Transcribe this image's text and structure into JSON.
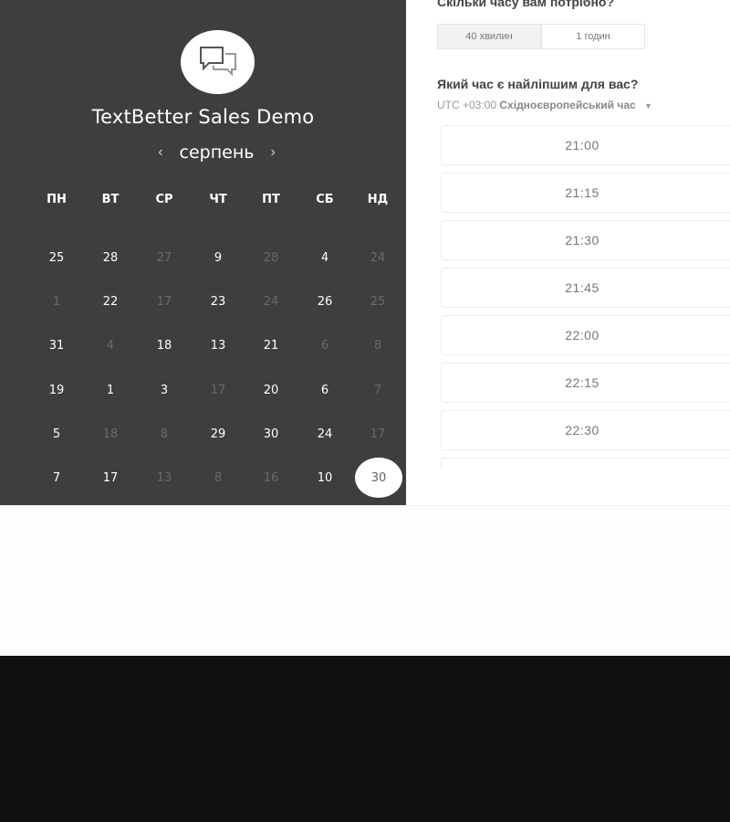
{
  "app": {
    "title": "TextBetter Sales Demo",
    "logo_icon": "chat-bubbles-icon"
  },
  "calendar": {
    "month": "серпень",
    "prev_icon": "chevron-left-icon",
    "next_icon": "chevron-right-icon",
    "weekdays": [
      "ПН",
      "ВТ",
      "СР",
      "ЧТ",
      "ПТ",
      "СБ",
      "НД"
    ],
    "weeks": [
      [
        {
          "d": "25",
          "on": true
        },
        {
          "d": "28",
          "on": true
        },
        {
          "d": "27",
          "on": false
        },
        {
          "d": "9",
          "on": true
        },
        {
          "d": "28",
          "on": false
        },
        {
          "d": "4",
          "on": true
        },
        {
          "d": "24",
          "on": false
        }
      ],
      [
        {
          "d": "1",
          "on": false
        },
        {
          "d": "22",
          "on": true
        },
        {
          "d": "17",
          "on": false
        },
        {
          "d": "23",
          "on": true
        },
        {
          "d": "24",
          "on": false
        },
        {
          "d": "26",
          "on": true
        },
        {
          "d": "25",
          "on": false
        }
      ],
      [
        {
          "d": "31",
          "on": true
        },
        {
          "d": "4",
          "on": false
        },
        {
          "d": "18",
          "on": true
        },
        {
          "d": "13",
          "on": true
        },
        {
          "d": "21",
          "on": true
        },
        {
          "d": "6",
          "on": false
        },
        {
          "d": "8",
          "on": false
        }
      ],
      [
        {
          "d": "19",
          "on": true
        },
        {
          "d": "1",
          "on": true
        },
        {
          "d": "3",
          "on": true
        },
        {
          "d": "17",
          "on": false
        },
        {
          "d": "20",
          "on": true
        },
        {
          "d": "6",
          "on": true
        },
        {
          "d": "7",
          "on": false
        }
      ],
      [
        {
          "d": "5",
          "on": true
        },
        {
          "d": "18",
          "on": false
        },
        {
          "d": "8",
          "on": false
        },
        {
          "d": "29",
          "on": true
        },
        {
          "d": "30",
          "on": true
        },
        {
          "d": "24",
          "on": true
        },
        {
          "d": "17",
          "on": false
        }
      ],
      [
        {
          "d": "7",
          "on": true
        },
        {
          "d": "17",
          "on": true
        },
        {
          "d": "13",
          "on": false
        },
        {
          "d": "8",
          "on": false
        },
        {
          "d": "16",
          "on": false
        },
        {
          "d": "10",
          "on": true
        },
        {
          "d": "30",
          "on": true,
          "selected": true
        }
      ]
    ]
  },
  "booking": {
    "duration_question": "Скільки часу вам потрібно?",
    "durations": [
      {
        "label": "40 хвилин",
        "active": true
      },
      {
        "label": "1 годин",
        "active": false
      }
    ],
    "time_question": "Який час є найліпшим для вас?",
    "timezone_offset": "UTC +03:00",
    "timezone_name": "Східноєвропейський час",
    "timezone_caret_icon": "caret-down-icon",
    "slots": [
      "21:00",
      "21:15",
      "21:30",
      "21:45",
      "22:00",
      "22:15",
      "22:30",
      ""
    ]
  },
  "colors": {
    "panel_bg": "#3e3e3e",
    "footer_bg": "#111111"
  }
}
